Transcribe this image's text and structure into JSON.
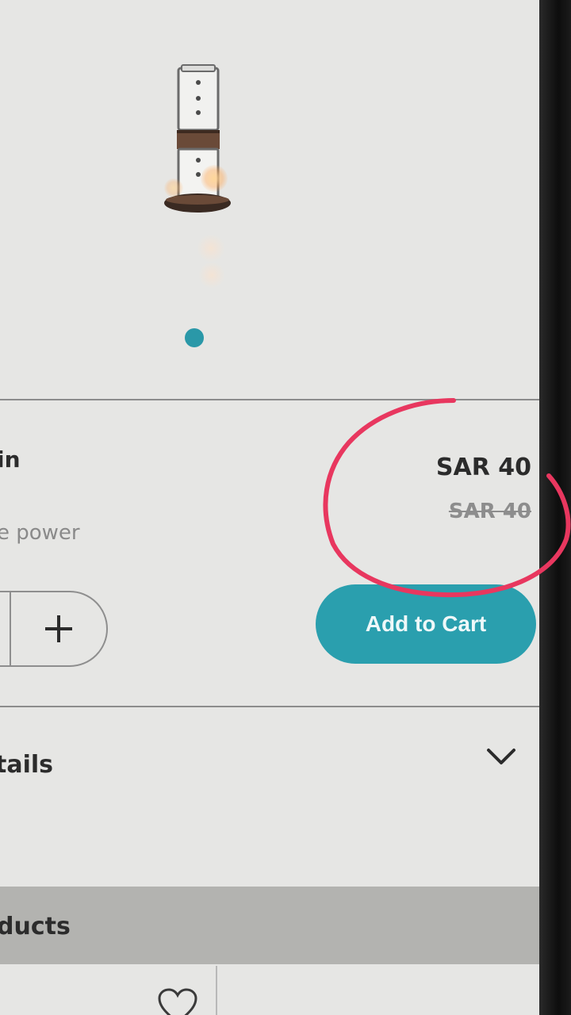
{
  "product": {
    "name_fragment": "in",
    "description_fragment": "e power",
    "price": "SAR 40",
    "original_price": "SAR 40",
    "carousel_pages": 1,
    "carousel_active": 1
  },
  "quantity": {
    "increment_icon": "plus-icon"
  },
  "actions": {
    "add_to_cart_label": "Add to Cart"
  },
  "details": {
    "label_fragment": "tails",
    "toggle_icon": "chevron-down-icon"
  },
  "related": {
    "title_fragment": "ducts",
    "card_icon": "heart-icon"
  },
  "colors": {
    "accent": "#2a9fae",
    "annotation": "#e8375f"
  }
}
